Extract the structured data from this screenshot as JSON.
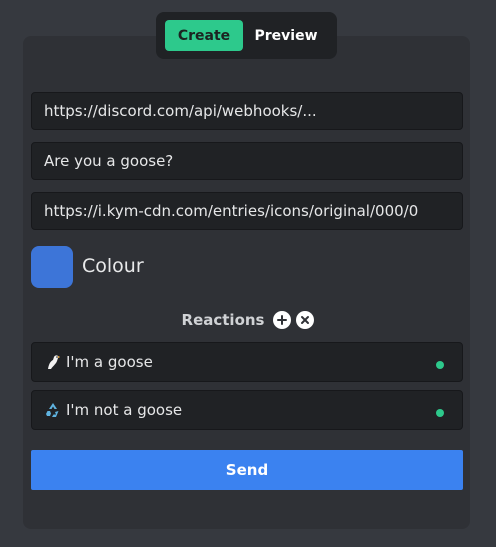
{
  "toggle": {
    "create_label": "Create",
    "preview_label": "Preview"
  },
  "form": {
    "webhook_url": "https://discord.com/api/webhooks/...",
    "message": "Are you a goose?",
    "icon_url": "https://i.kym-cdn.com/entries/icons/original/000/0",
    "colour_label": "Colour",
    "colour_value": "#3d75d8"
  },
  "reactions": {
    "title": "Reactions",
    "add_icon": "plus-circle-icon",
    "clear_icon": "close-circle-icon",
    "items": [
      {
        "emoji": "goose-emoji",
        "label": "I'm a goose",
        "status_color": "#2dc98c"
      },
      {
        "emoji": "recycle-emoji",
        "label": "I'm not a goose",
        "status_color": "#2dc98c"
      }
    ]
  },
  "send_label": "Send",
  "colors": {
    "accent_green": "#2dc98c",
    "send_blue": "#3b82f0"
  }
}
